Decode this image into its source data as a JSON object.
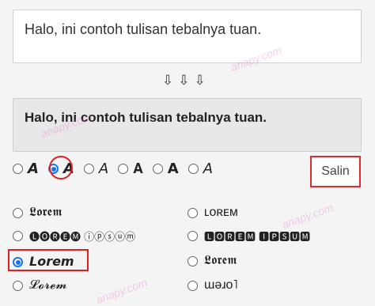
{
  "input_text": "Halo, ini contoh tulisan tebalnya tuan.",
  "arrows": "⇩⇩⇩",
  "output_text": "Halo, ini contoh tulisan tebalnya tuan.",
  "style_options": [
    "𝘼",
    "𝘼",
    "𝘈",
    "𝐀",
    "𝗔",
    "𝘈"
  ],
  "copy_button": "Salin",
  "font_options": [
    {
      "label": "𝕷𝖔𝖗𝖊𝖒",
      "selected": false
    },
    {
      "label": "ʟᴏʀᴇᴍ",
      "selected": false
    },
    {
      "label": "🅛🅞🅡🅔🅜 ⓘⓟⓢⓤⓜ",
      "selected": false
    },
    {
      "label": "🅻🅾🆁🅴🅼 🅸🅿🆂🆄🅼",
      "selected": false
    },
    {
      "label": "𝙇𝙤𝙧𝙚𝙢",
      "selected": true
    },
    {
      "label": "𝕷𝖔𝖗𝖊𝖒",
      "selected": false
    },
    {
      "label": "𝓛𝓸𝓻𝓮𝓶",
      "selected": false
    },
    {
      "label": "ɯǝɹo˥",
      "selected": false
    }
  ],
  "watermark": "anapy.com"
}
